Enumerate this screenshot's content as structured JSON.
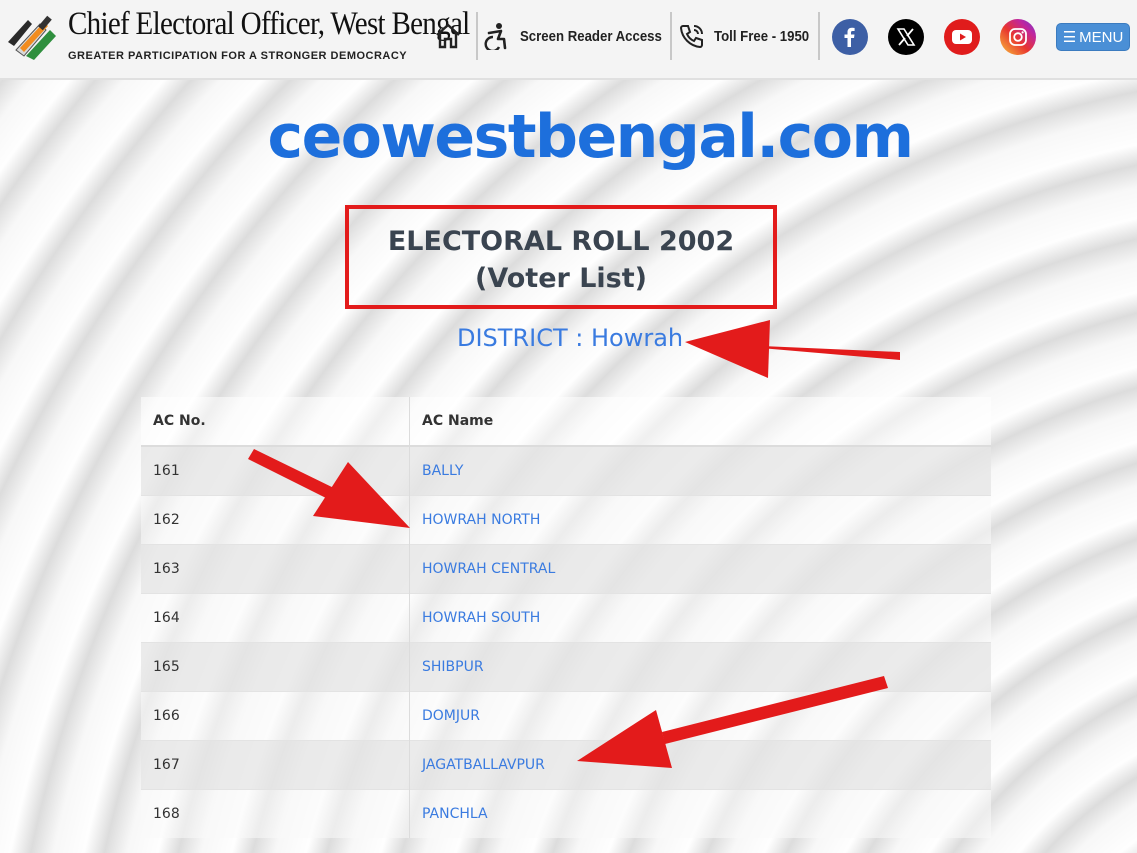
{
  "header": {
    "title": "Chief Electoral Officer, West Bengal",
    "tagline": "GREATER PARTICIPATION FOR A STRONGER DEMOCRACY",
    "screen_reader": "Screen Reader Access",
    "toll_free": "Toll Free - 1950",
    "menu_label": "MENU",
    "icons": [
      "home-icon",
      "accessibility-icon",
      "phone-icon",
      "facebook-icon",
      "x-icon",
      "youtube-icon",
      "instagram-icon"
    ]
  },
  "main": {
    "site_name": "ceowestbengal.com",
    "roll_title": "ELECTORAL ROLL 2002",
    "roll_subtitle": "(Voter List)",
    "district": "DISTRICT : Howrah"
  },
  "table": {
    "headers": [
      "AC No.",
      "AC Name"
    ],
    "rows": [
      {
        "no": "161",
        "name": "BALLY"
      },
      {
        "no": "162",
        "name": "HOWRAH NORTH"
      },
      {
        "no": "163",
        "name": "HOWRAH CENTRAL"
      },
      {
        "no": "164",
        "name": "HOWRAH SOUTH"
      },
      {
        "no": "165",
        "name": "SHIBPUR"
      },
      {
        "no": "166",
        "name": "DOMJUR"
      },
      {
        "no": "167",
        "name": "JAGATBALLAVPUR"
      },
      {
        "no": "168",
        "name": "PANCHLA"
      }
    ]
  },
  "colors": {
    "brand_blue": "#1d6fdc",
    "link_blue": "#3a7be0",
    "annotation_red": "#e31b1b",
    "menu_blue": "#4a8fd6"
  }
}
